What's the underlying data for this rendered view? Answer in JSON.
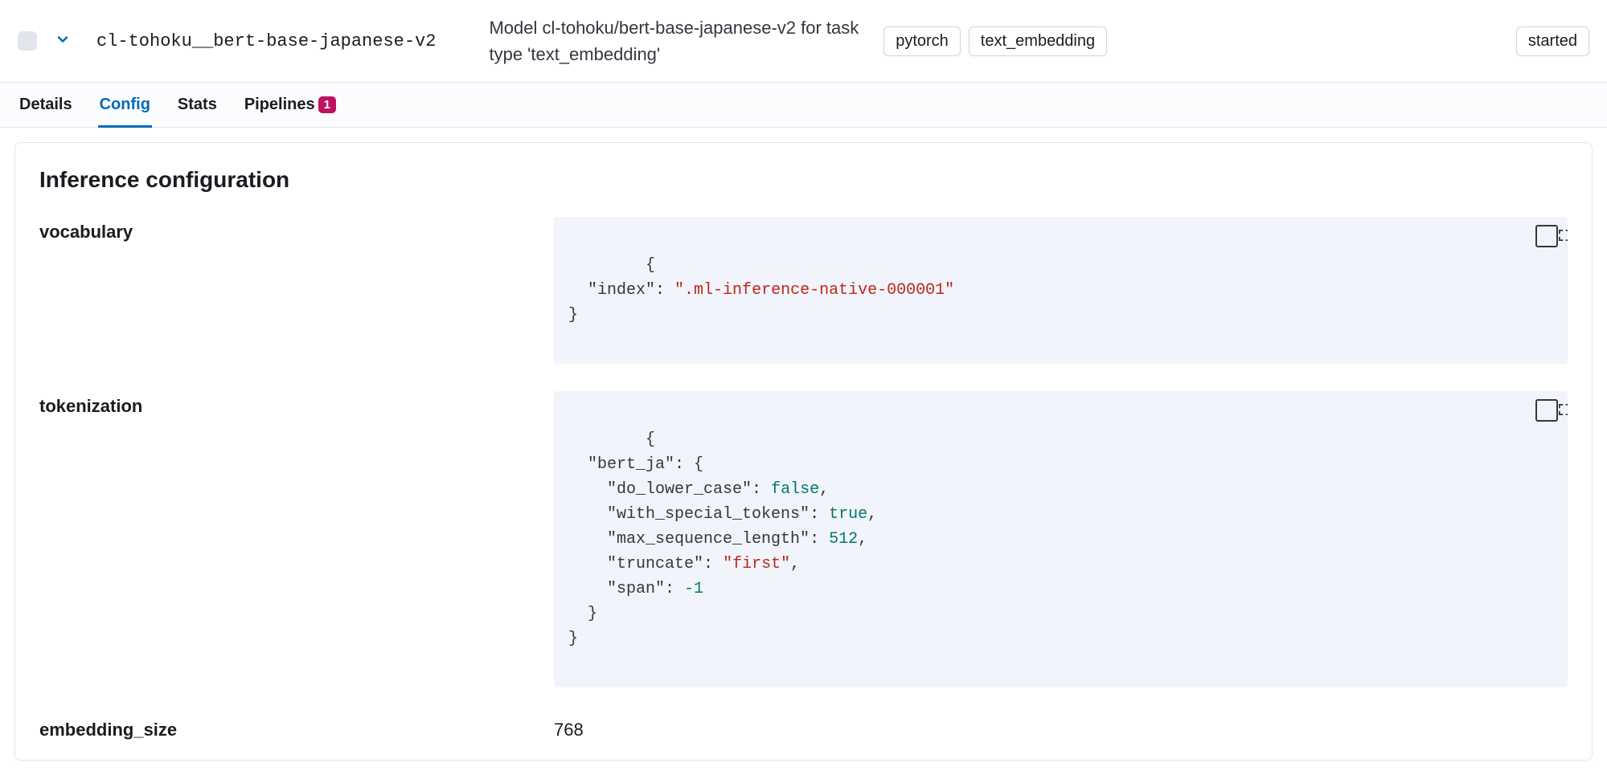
{
  "header": {
    "model_id": "cl-tohoku__bert-base-japanese-v2",
    "description": "Model cl-tohoku/bert-base-japanese-v2 for task type 'text_embedding'",
    "badges": {
      "framework": "pytorch",
      "task_type": "text_embedding",
      "state": "started"
    }
  },
  "tabs": {
    "details": "Details",
    "config": "Config",
    "stats": "Stats",
    "pipelines": "Pipelines",
    "pipelines_count": "1"
  },
  "panel": {
    "title": "Inference configuration",
    "vocabulary_label": "vocabulary",
    "tokenization_label": "tokenization",
    "embedding_size_label": "embedding_size",
    "embedding_size_value": "768"
  },
  "config": {
    "vocabulary": {
      "index": ".ml-inference-native-000001"
    },
    "tokenization": {
      "bert_ja": {
        "do_lower_case": false,
        "with_special_tokens": true,
        "max_sequence_length": 512,
        "truncate": "first",
        "span": -1
      }
    }
  }
}
